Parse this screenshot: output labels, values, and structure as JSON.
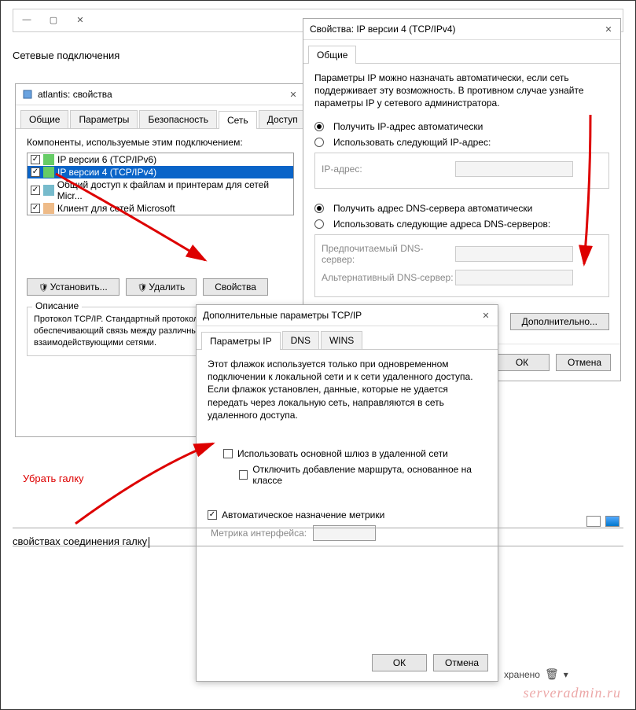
{
  "page_header": "Сетевые подключения",
  "bottom_text": "свойствах соединения галку",
  "red_annotation": "Убрать галку",
  "watermark": "serveradmin.ru",
  "not_saved": "хранено",
  "win1": {
    "title": "atlantis: свойства",
    "tabs": [
      "Общие",
      "Параметры",
      "Безопасность",
      "Сеть",
      "Доступ"
    ],
    "components_label": "Компоненты, используемые этим подключением:",
    "items": [
      "IP версии 6 (TCP/IPv6)",
      "IP версии 4 (TCP/IPv4)",
      "Общий доступ к файлам и принтерам для сетей Micr...",
      "Клиент для сетей Microsoft"
    ],
    "btn_install": "Установить...",
    "btn_delete": "Удалить",
    "btn_props": "Свойства",
    "desc_title": "Описание",
    "desc_text": "Протокол TCP/IP. Стандартный протокол глобальных сетей, обеспечивающий связь между различными взаимодействующими сетями."
  },
  "win2": {
    "title": "Свойства: IP версии 4 (TCP/IPv4)",
    "tab": "Общие",
    "info": "Параметры IP можно назначать автоматически, если сеть поддерживает эту возможность. В противном случае узнайте параметры IP у сетевого администратора.",
    "r1": "Получить IP-адрес автоматически",
    "r2": "Использовать следующий IP-адрес:",
    "ip_label": "IP-адрес:",
    "r3": "Получить адрес DNS-сервера автоматически",
    "r4": "Использовать следующие адреса DNS-серверов:",
    "dns1": "Предпочитаемый DNS-сервер:",
    "dns2": "Альтернативный DNS-сервер:",
    "btn_adv": "Дополнительно...",
    "btn_ok": "ОК",
    "btn_cancel": "Отмена"
  },
  "win3": {
    "title": "Дополнительные параметры TCP/IP",
    "tabs": [
      "Параметры IP",
      "DNS",
      "WINS"
    ],
    "info": "Этот флажок используется только при одновременном подключении к локальной сети и к сети удаленного доступа. Если флажок установлен, данные, которые не удается передать через локальную сеть, направляются в сеть удаленного доступа.",
    "chk1": "Использовать основной шлюз в удаленной сети",
    "chk2": "Отключить добавление маршрута, основанное на классе",
    "chk3": "Автоматическое назначение метрики",
    "metric_label": "Метрика интерфейса:",
    "btn_ok": "ОК",
    "btn_cancel": "Отмена"
  }
}
